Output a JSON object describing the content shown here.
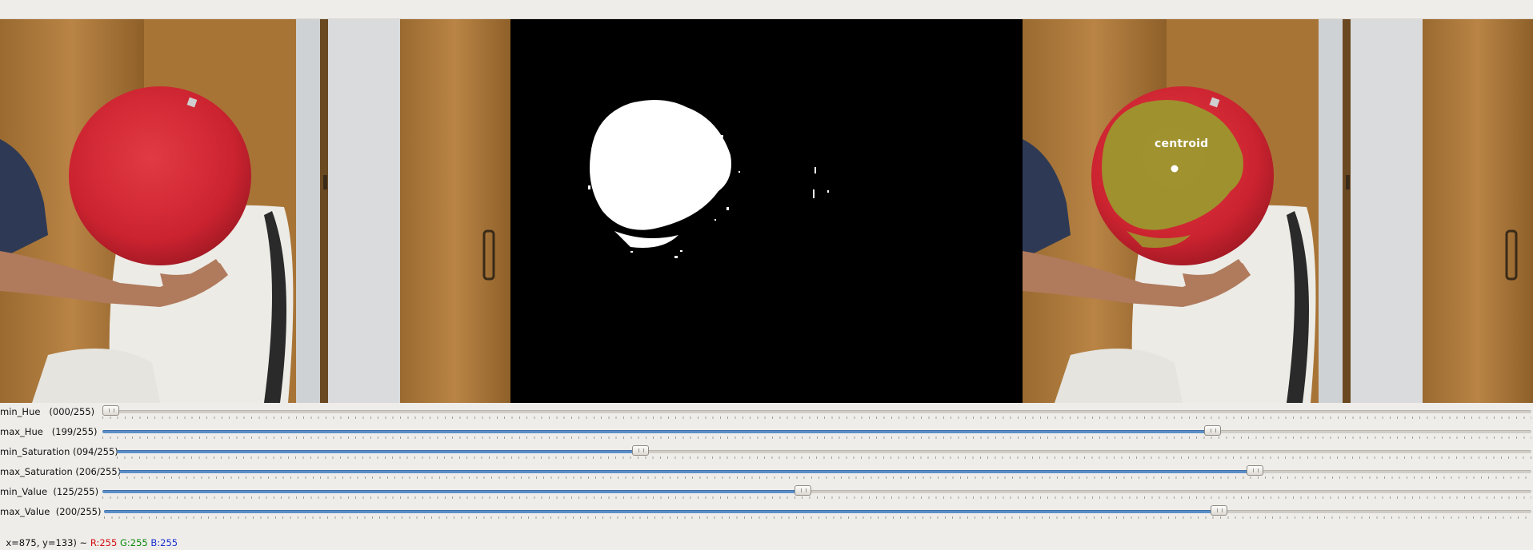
{
  "overlay_text": "centroid",
  "sliders": [
    {
      "label": "min_Hue",
      "value_text": "(000/255)",
      "value": 0
    },
    {
      "label": "max_Hue",
      "value_text": "(199/255)",
      "value": 199
    },
    {
      "label": "min_Saturation",
      "value_text": "(094/255)",
      "value": 94
    },
    {
      "label": "max_Saturation",
      "value_text": "(206/255)",
      "value": 206
    },
    {
      "label": "min_Value",
      "value_text": "(125/255)",
      "value": 125
    },
    {
      "label": "max_Value",
      "value_text": "(200/255)",
      "value": 200
    }
  ],
  "status": {
    "coords": "x=875, y=133) ~",
    "r": "R:255",
    "g": "G:255",
    "b": "B:255"
  },
  "colors": {
    "ball_red": "#d42a35",
    "mask_overlay": "#9a9a2e",
    "slider_accent": "#5b8fc9"
  }
}
